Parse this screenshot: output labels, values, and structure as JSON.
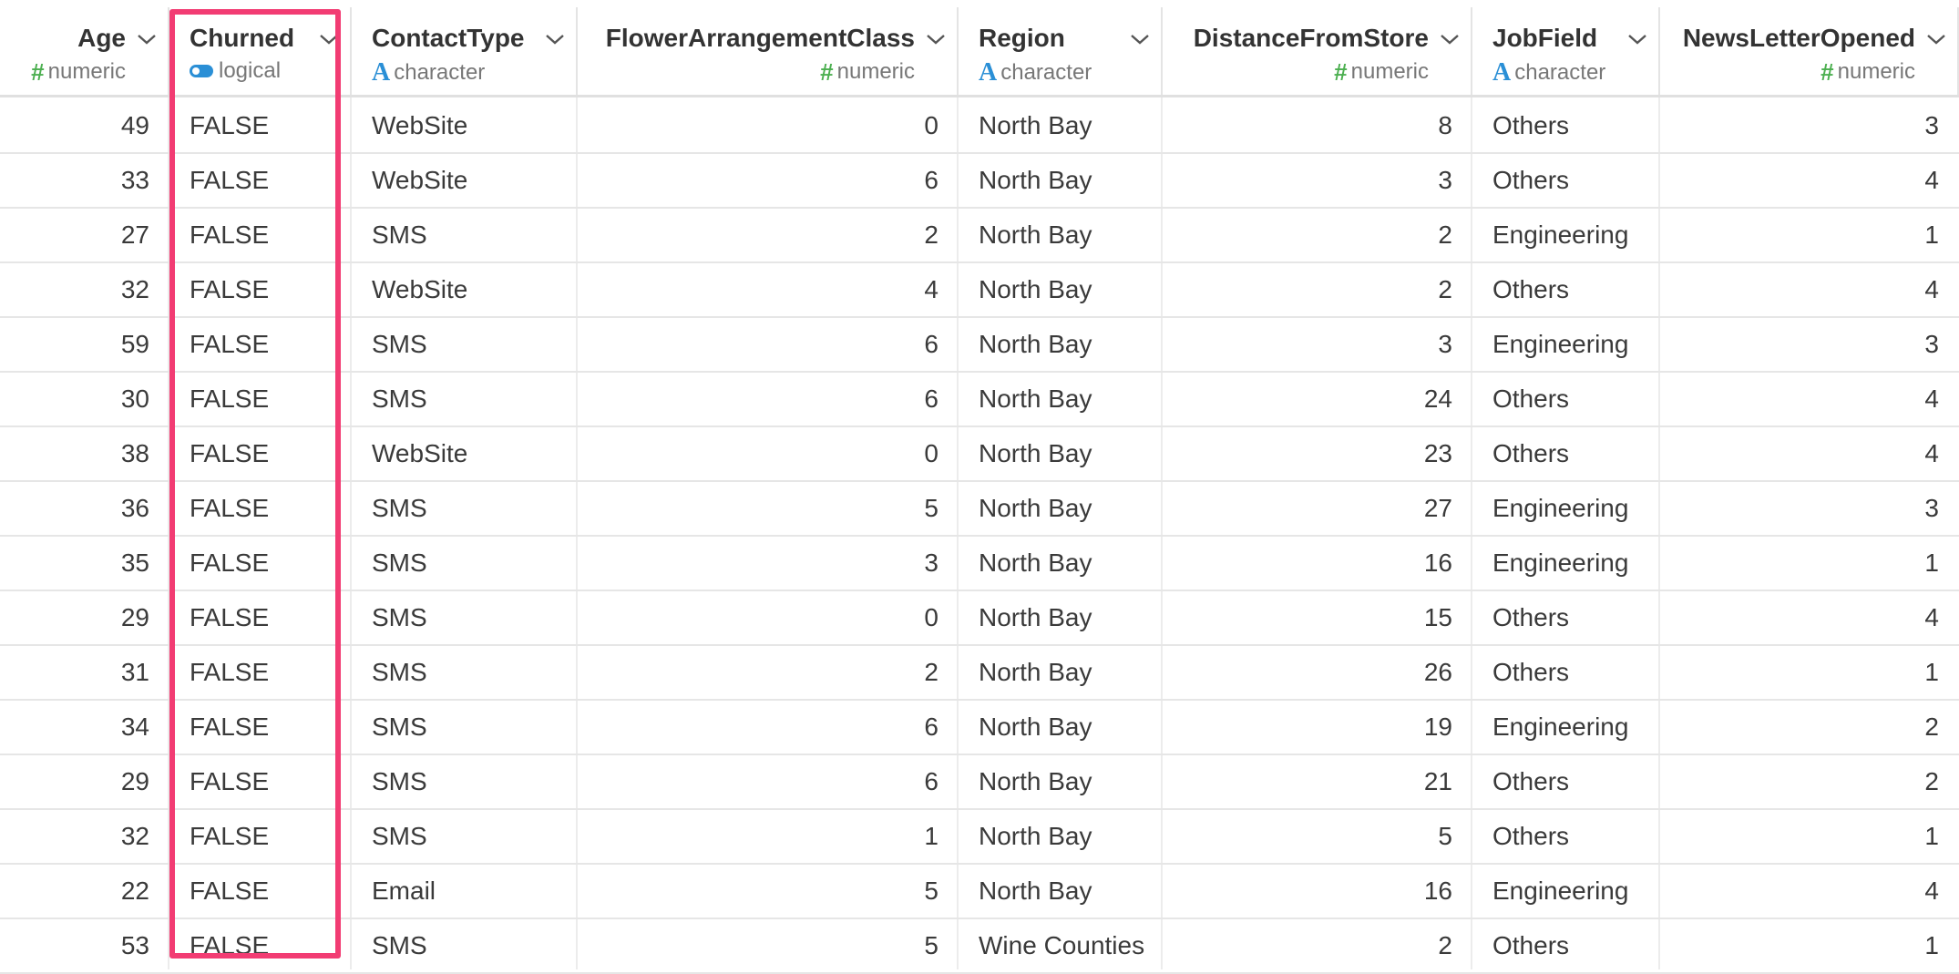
{
  "columns": [
    {
      "name": "Age",
      "type": "numeric",
      "type_icon": "hash-icon"
    },
    {
      "name": "Churned",
      "type": "logical",
      "type_icon": "toggle-icon"
    },
    {
      "name": "ContactType",
      "type": "character",
      "type_icon": "letter-a-icon"
    },
    {
      "name": "FlowerArrangementClass",
      "type": "numeric",
      "type_icon": "hash-icon"
    },
    {
      "name": "Region",
      "type": "character",
      "type_icon": "letter-a-icon"
    },
    {
      "name": "DistanceFromStore",
      "type": "numeric",
      "type_icon": "hash-icon"
    },
    {
      "name": "JobField",
      "type": "character",
      "type_icon": "letter-a-icon"
    },
    {
      "name": "NewsLetterOpened",
      "type": "numeric",
      "type_icon": "hash-icon"
    }
  ],
  "rows": [
    [
      "49",
      "FALSE",
      "WebSite",
      "0",
      "North Bay",
      "8",
      "Others",
      "3"
    ],
    [
      "33",
      "FALSE",
      "WebSite",
      "6",
      "North Bay",
      "3",
      "Others",
      "4"
    ],
    [
      "27",
      "FALSE",
      "SMS",
      "2",
      "North Bay",
      "2",
      "Engineering",
      "1"
    ],
    [
      "32",
      "FALSE",
      "WebSite",
      "4",
      "North Bay",
      "2",
      "Others",
      "4"
    ],
    [
      "59",
      "FALSE",
      "SMS",
      "6",
      "North Bay",
      "3",
      "Engineering",
      "3"
    ],
    [
      "30",
      "FALSE",
      "SMS",
      "6",
      "North Bay",
      "24",
      "Others",
      "4"
    ],
    [
      "38",
      "FALSE",
      "WebSite",
      "0",
      "North Bay",
      "23",
      "Others",
      "4"
    ],
    [
      "36",
      "FALSE",
      "SMS",
      "5",
      "North Bay",
      "27",
      "Engineering",
      "3"
    ],
    [
      "35",
      "FALSE",
      "SMS",
      "3",
      "North Bay",
      "16",
      "Engineering",
      "1"
    ],
    [
      "29",
      "FALSE",
      "SMS",
      "0",
      "North Bay",
      "15",
      "Others",
      "4"
    ],
    [
      "31",
      "FALSE",
      "SMS",
      "2",
      "North Bay",
      "26",
      "Others",
      "1"
    ],
    [
      "34",
      "FALSE",
      "SMS",
      "6",
      "North Bay",
      "19",
      "Engineering",
      "2"
    ],
    [
      "29",
      "FALSE",
      "SMS",
      "6",
      "North Bay",
      "21",
      "Others",
      "2"
    ],
    [
      "32",
      "FALSE",
      "SMS",
      "1",
      "North Bay",
      "5",
      "Others",
      "1"
    ],
    [
      "22",
      "FALSE",
      "Email",
      "5",
      "North Bay",
      "16",
      "Engineering",
      "4"
    ],
    [
      "53",
      "FALSE",
      "SMS",
      "5",
      "Wine Counties",
      "2",
      "Others",
      "1"
    ]
  ],
  "highlight": {
    "column": "Churned",
    "color": "#f23c73"
  },
  "colors": {
    "numeric_icon": "#4caf50",
    "character_icon": "#2a8fd6",
    "logical_icon": "#2a8fd6"
  }
}
